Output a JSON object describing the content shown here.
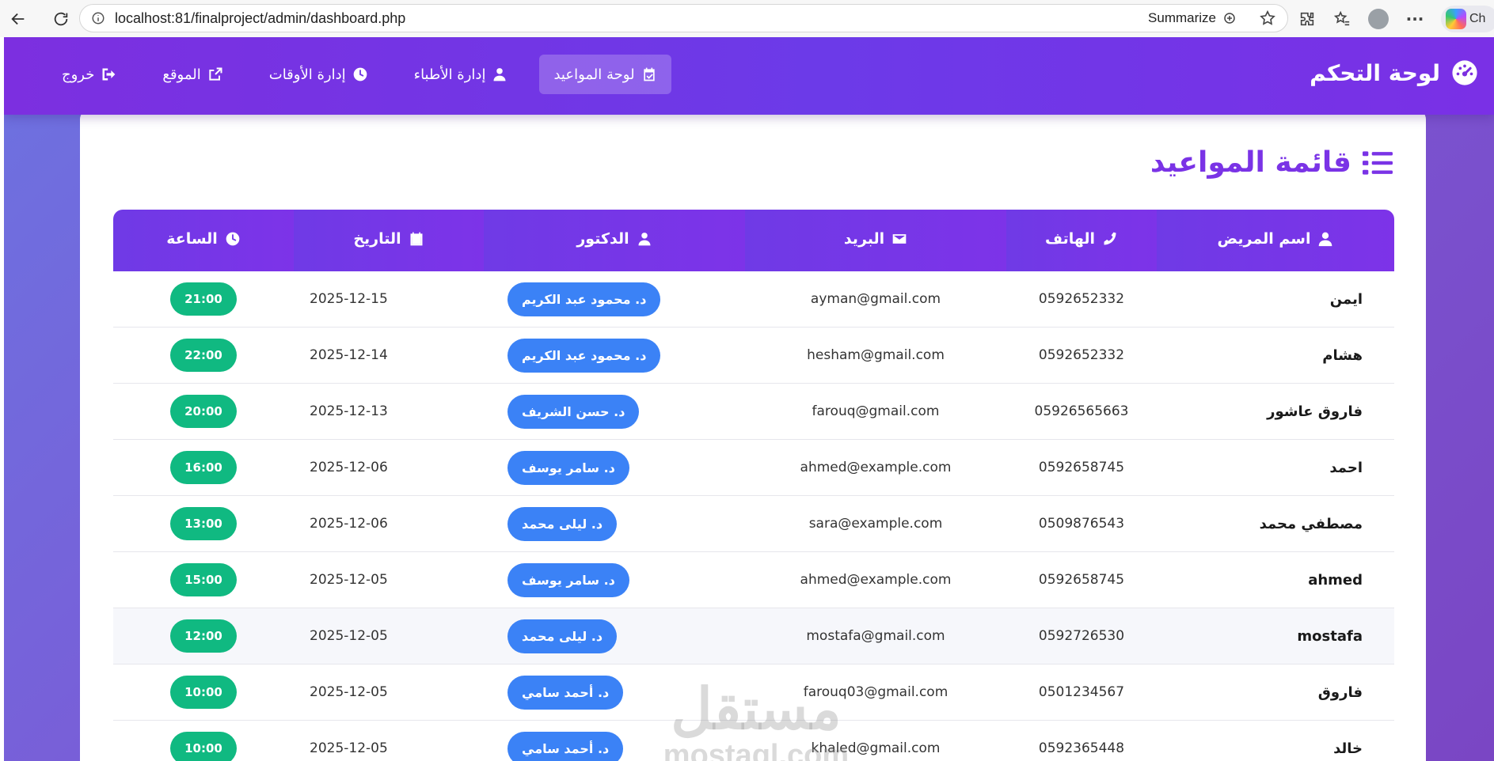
{
  "browser": {
    "url": "localhost:81/finalproject/admin/dashboard.php",
    "summarize_label": "Summarize",
    "copilot_label": "Ch"
  },
  "header": {
    "brand": "لوحة التحكم",
    "nav": [
      {
        "label": "لوحة المواعيد",
        "icon": "calendar-check-icon",
        "active": true
      },
      {
        "label": "إدارة الأطباء",
        "icon": "user-doctor-icon"
      },
      {
        "label": "إدارة الأوقات",
        "icon": "clock-icon"
      },
      {
        "label": "الموقع",
        "icon": "external-link-icon"
      },
      {
        "label": "خروج",
        "icon": "sign-out-icon"
      }
    ]
  },
  "main": {
    "title": "قائمة المواعيد",
    "columns": [
      "اسم المريض",
      "الهاتف",
      "البريد",
      "الدكتور",
      "التاريخ",
      "الساعة"
    ],
    "rows": [
      {
        "name": "ايمن",
        "phone": "0592652332",
        "email": "ayman@gmail.com",
        "doctor": "د. محمود عبد الكريم",
        "date": "2025-12-15",
        "time": "21:00"
      },
      {
        "name": "هشام",
        "phone": "0592652332",
        "email": "hesham@gmail.com",
        "doctor": "د. محمود عبد الكريم",
        "date": "2025-12-14",
        "time": "22:00"
      },
      {
        "name": "فاروق عاشور",
        "phone": "05926565663",
        "email": "farouq@gmail.com",
        "doctor": "د. حسن الشريف",
        "date": "2025-12-13",
        "time": "20:00"
      },
      {
        "name": "احمد",
        "phone": "0592658745",
        "email": "ahmed@example.com",
        "doctor": "د. سامر يوسف",
        "date": "2025-12-06",
        "time": "16:00"
      },
      {
        "name": "مصطفي محمد",
        "phone": "0509876543",
        "email": "sara@example.com",
        "doctor": "د. ليلى محمد",
        "date": "2025-12-06",
        "time": "13:00"
      },
      {
        "name": "ahmed",
        "phone": "0592658745",
        "email": "ahmed@example.com",
        "doctor": "د. سامر يوسف",
        "date": "2025-12-05",
        "time": "15:00"
      },
      {
        "name": "mostafa",
        "phone": "0592726530",
        "email": "mostafa@gmail.com",
        "doctor": "د. ليلى محمد",
        "date": "2025-12-05",
        "time": "12:00"
      },
      {
        "name": "فاروق",
        "phone": "0501234567",
        "email": "farouq03@gmail.com",
        "doctor": "د. أحمد سامي",
        "date": "2025-12-05",
        "time": "10:00"
      },
      {
        "name": "خالد",
        "phone": "0592365448",
        "email": "khaled@gmail.com",
        "doctor": "د. أحمد سامي",
        "date": "2025-12-05",
        "time": "10:00"
      }
    ]
  },
  "watermark": {
    "arabic": "مستقل",
    "latin": "mostaql.com"
  },
  "colors": {
    "primary": "#7c3aed",
    "doctor_pill": "#3b82f6",
    "time_pill": "#10b981"
  }
}
